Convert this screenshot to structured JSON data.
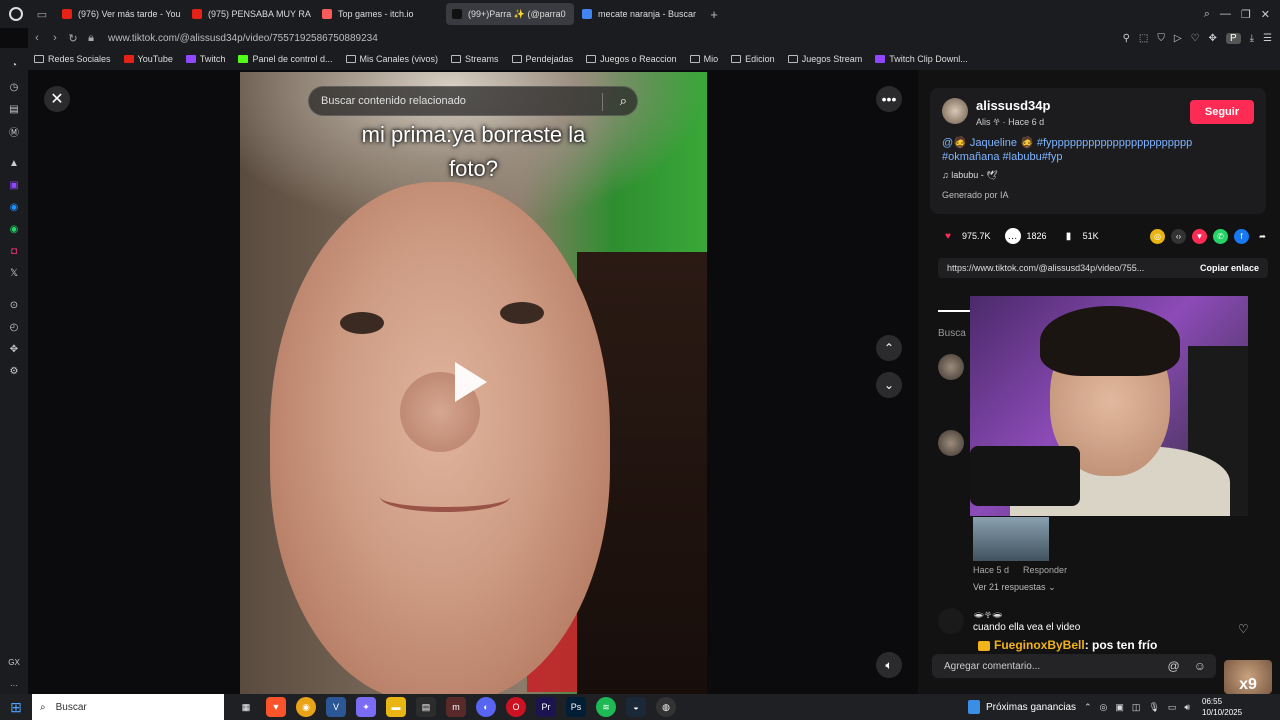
{
  "browser": {
    "tabs": [
      {
        "title": "(976) Ver más tarde - You",
        "color": "#e62117",
        "active": false
      },
      {
        "title": "(975) PENSABA MUY RA",
        "color": "#e62117",
        "active": false
      },
      {
        "title": "Top games - itch.io",
        "color": "#fa5c5c",
        "active": false
      },
      {
        "title": "(99+)Parra ✨ (@parra0",
        "color": "#111111",
        "active": true
      },
      {
        "title": "mecate naranja - Buscar",
        "color": "#4285f4",
        "active": false
      }
    ],
    "url": "www.tiktok.com/@alissusd34p/video/7557192586750889234",
    "profile_badge": "P",
    "bookmarks": [
      {
        "label": "Redes Sociales",
        "icon": "folder-icon"
      },
      {
        "label": "YouTube",
        "icon": "youtube-icon"
      },
      {
        "label": "Twitch",
        "icon": "twitch-icon"
      },
      {
        "label": "Panel de control d...",
        "icon": "kick-icon"
      },
      {
        "label": "Mis Canales (vivos)",
        "icon": "folder-icon"
      },
      {
        "label": "Streams",
        "icon": "folder-icon"
      },
      {
        "label": "Pendejadas",
        "icon": "folder-icon"
      },
      {
        "label": "Juegos o Reaccion",
        "icon": "folder-icon"
      },
      {
        "label": "Mio",
        "icon": "folder-icon"
      },
      {
        "label": "Edicion",
        "icon": "folder-icon"
      },
      {
        "label": "Juegos Stream",
        "icon": "folder-icon"
      },
      {
        "label": "Twitch Clip Downl...",
        "icon": "clip-icon"
      }
    ],
    "sidebar_bottom": "GX"
  },
  "video": {
    "search_placeholder": "Buscar contenido relacionado",
    "caption_line1": "mi prima:ya borraste la",
    "caption_line2": "foto?"
  },
  "post": {
    "username": "alissusd34p",
    "display_name": "Alis 𖣂",
    "time": "Hace 6 d",
    "follow_label": "Seguir",
    "mention": "@🧔 Jaqueline 🧔",
    "hashtags": "#fyppppppppppppppppppppppp #okmañana #labubu#fyp",
    "music": "labubu - 🕊",
    "ai_label": "Generado por IA",
    "likes": "975.7K",
    "comments": "1826",
    "saves": "51K",
    "share_link": "https://www.tiktok.com/@alissusd34p/video/755...",
    "copy_label": "Copiar enlace",
    "buscar_partial": "Busca",
    "comment1_time": "Hace 5 d",
    "comment1_reply": "Responder",
    "comment1_replies": "Ver 21 respuestas",
    "comment2_name": "🕳𖣂🕳",
    "comment2_text": "cuando ella vea el video",
    "add_comment_placeholder": "Agregar comentario...",
    "colors": {
      "accent": "#fe2c55",
      "link": "#7fb4ff"
    }
  },
  "chat": {
    "name": "FueginoxByBell",
    "message": ": pos ten frío"
  },
  "overlay_text": "x9",
  "taskbar": {
    "search_label": "Buscar",
    "earnings_label": "Próximas ganancias",
    "time": "06:55",
    "date": "10/10/2025"
  }
}
